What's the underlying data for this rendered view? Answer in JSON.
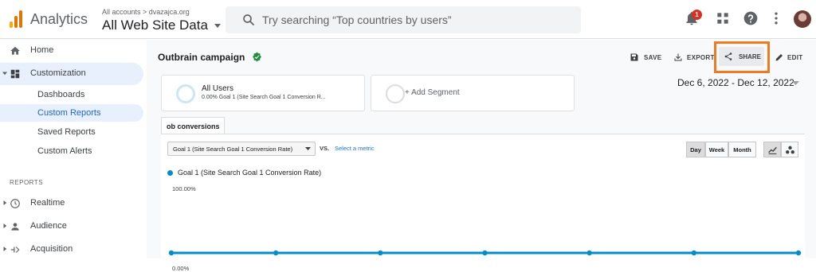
{
  "header": {
    "brand": "Analytics",
    "account_path": "All accounts > dvazajca.org",
    "view_name": "All Web Site Data",
    "search_placeholder": "Try searching “Top countries by users”",
    "notification_count": "1",
    "icons": [
      "search-icon",
      "bell-icon",
      "apps-grid-icon",
      "help-icon",
      "more-vert-icon",
      "avatar"
    ]
  },
  "sidebar": {
    "home": "Home",
    "customization": "Customization",
    "sub_items": [
      "Dashboards",
      "Custom Reports",
      "Saved Reports",
      "Custom Alerts"
    ],
    "active_sub": "Custom Reports",
    "reports_heading": "REPORTS",
    "reports": [
      "Realtime",
      "Audience",
      "Acquisition"
    ]
  },
  "toolbar": {
    "title": "Outbrain campaign",
    "save": "SAVE",
    "export": "EXPORT",
    "share": "SHARE",
    "edit": "EDIT"
  },
  "segments": {
    "primary_name": "All Users",
    "primary_desc": "0.00% Goal 1 (Site Search Goal 1 Conversion R...",
    "add_label": "+ Add Segment"
  },
  "date_range": "Dec 6, 2022 - Dec 12, 2022",
  "tab": "ob conversions",
  "chart_controls": {
    "metric": "Goal 1 (Site Search Goal 1 Conversion Rate)",
    "vs": "VS.",
    "select_metric": "Select a metric",
    "granularity": [
      "Day",
      "Week",
      "Month"
    ],
    "selected_granularity": "Day"
  },
  "colors": {
    "series": "#058dc7",
    "accent": "#1a73e8",
    "highlight_box": "#f07a22",
    "verified": "#1e8e3e"
  },
  "chart_data": {
    "type": "line",
    "legend_position": "top-left",
    "grid": false,
    "y_tick_labels": [
      "100.00%",
      "0.00%"
    ],
    "ylim": [
      0,
      100
    ],
    "series": [
      {
        "name": "Goal 1 (Site Search Goal 1 Conversion Rate)",
        "values": [
          0,
          0,
          0,
          0,
          0,
          0,
          0
        ]
      }
    ]
  }
}
